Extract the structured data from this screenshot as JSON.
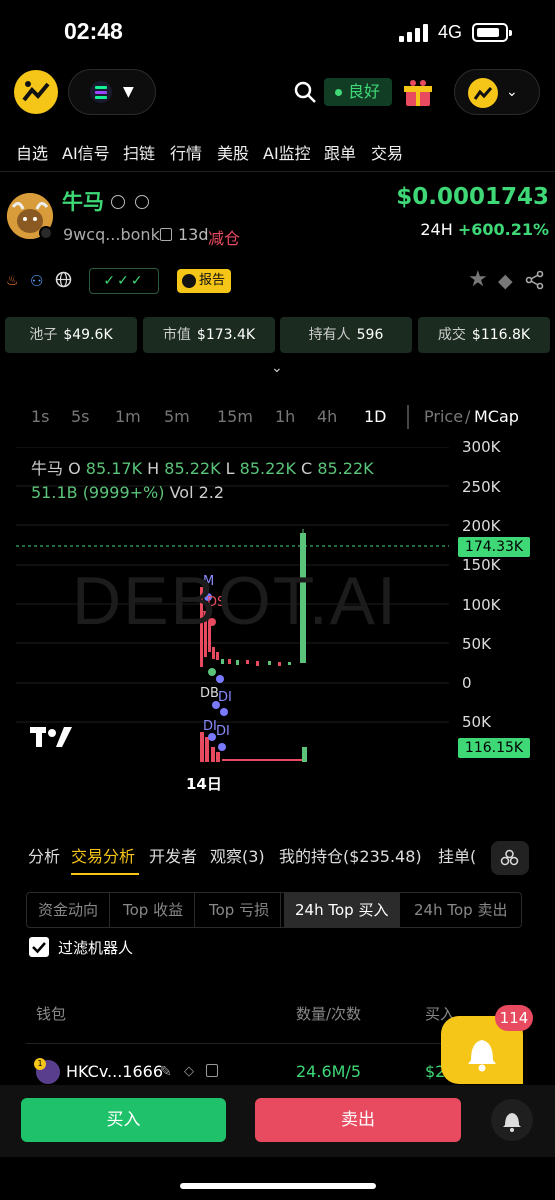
{
  "status_bar": {
    "time": "02:48",
    "network": "4G"
  },
  "top_bar": {
    "health_label": "良好"
  },
  "nav": {
    "items": [
      "自选",
      "AI信号",
      "扫链",
      "行情",
      "美股",
      "AI监控",
      "跟单",
      "交易"
    ]
  },
  "token": {
    "name": "牛马",
    "address": "9wcq...bonk",
    "age": "13d",
    "tag": "减仓",
    "price": "$0.0001743",
    "change_label": "24H",
    "change_value": "+600.21%",
    "checks": "✓✓✓",
    "report_label": "报告"
  },
  "stats": [
    {
      "label": "池子",
      "value": "$49.6K"
    },
    {
      "label": "市值",
      "value": "$173.4K"
    },
    {
      "label": "持有人",
      "value": "596"
    },
    {
      "label": "成交",
      "value": "$116.8K"
    }
  ],
  "timeframes": [
    "1s",
    "5s",
    "1m",
    "5m",
    "15m",
    "1h",
    "4h",
    "1D"
  ],
  "active_timeframe": "1D",
  "price_toggle": {
    "price": "Price",
    "divider": "/",
    "mcap": "MCap"
  },
  "chart": {
    "ohlc_line1": "牛马 O ",
    "o": "85.17K",
    "h_label": " H ",
    "h": "85.22K",
    "l_label": " L ",
    "l": "85.22K",
    "c_label": " C ",
    "c": "85.22K",
    "ohlc_line2": "51.1B (9999+%)",
    "vol": " Vol 2.2",
    "watermark": "DEBOT.AI",
    "y_ticks": [
      "300K",
      "250K",
      "200K",
      "150K",
      "100K",
      "50K",
      "0",
      "50K"
    ],
    "price_tag": "174.33K",
    "vol_tag": "116.15K",
    "x_label": "14日",
    "markers": [
      "M",
      "DS",
      "D",
      "DB",
      "DI",
      "DI",
      "DI"
    ]
  },
  "chart_data": {
    "type": "candlestick",
    "y_unit": "MCap",
    "ylim": [
      0,
      300000
    ],
    "current_price": 174330,
    "current_volume": 116150,
    "x_label": "14日"
  },
  "analysis_tabs": [
    "分析",
    "交易分析",
    "开发者",
    "观察(3)",
    "我的持仓($235.48)",
    "挂单("
  ],
  "sub_tabs": [
    "资金动向",
    "Top 收益",
    "Top 亏损",
    "24h Top 买入",
    "24h Top 卖出"
  ],
  "filter": {
    "label": "过滤机器人",
    "checked": true
  },
  "table": {
    "headers": [
      "钱包",
      "数量/次数",
      "买入"
    ],
    "rows": [
      {
        "rank": "1",
        "wallet": "HKCv...1666",
        "qty": "24.6M/5",
        "buy": "$2"
      }
    ]
  },
  "notification_count": "114",
  "actions": {
    "buy": "买入",
    "sell": "卖出"
  },
  "colors": {
    "green": "#3fd877",
    "red": "#e84a5f",
    "yellow": "#f5c518"
  }
}
